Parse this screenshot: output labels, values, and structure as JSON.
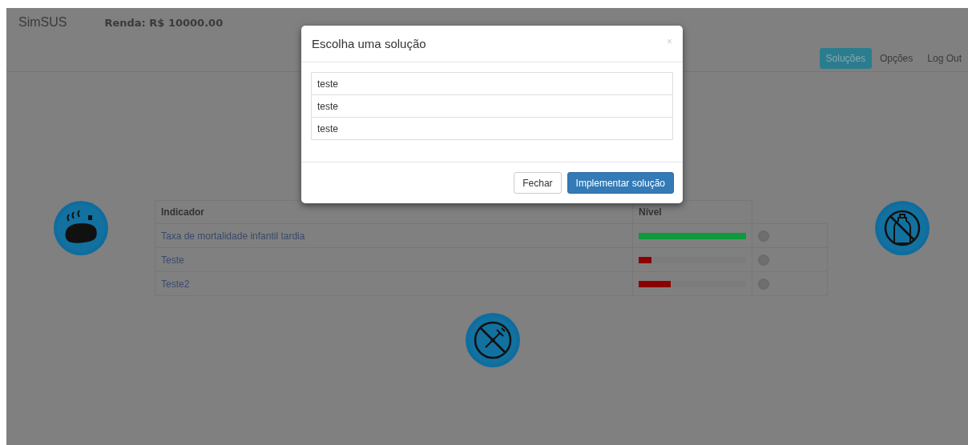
{
  "navbar": {
    "brand": "SimSUS",
    "income": "Renda: R$ 10000.00",
    "nav_items": [
      {
        "label": "Soluções",
        "selected": true
      },
      {
        "label": "Opções",
        "selected": false
      },
      {
        "label": "Log Out",
        "selected": false
      }
    ]
  },
  "table": {
    "columns": [
      "Indicador",
      "Nível"
    ],
    "rows": [
      {
        "indicator": "Taxa de mortalidade infantil tardia",
        "level": 1,
        "color": "#0c9a3c"
      },
      {
        "indicator": "Teste",
        "level": 0.12,
        "color": "#8b0000"
      },
      {
        "indicator": "Teste2",
        "level": 0.3,
        "color": "#8b0000"
      }
    ]
  },
  "modal": {
    "title": "Escolha uma solução",
    "close": "×",
    "options": [
      "teste",
      "teste",
      "teste"
    ],
    "buttons": [
      {
        "label": "Fechar",
        "kind": "default"
      },
      {
        "label": "Implementar solução",
        "kind": "primary"
      }
    ]
  }
}
